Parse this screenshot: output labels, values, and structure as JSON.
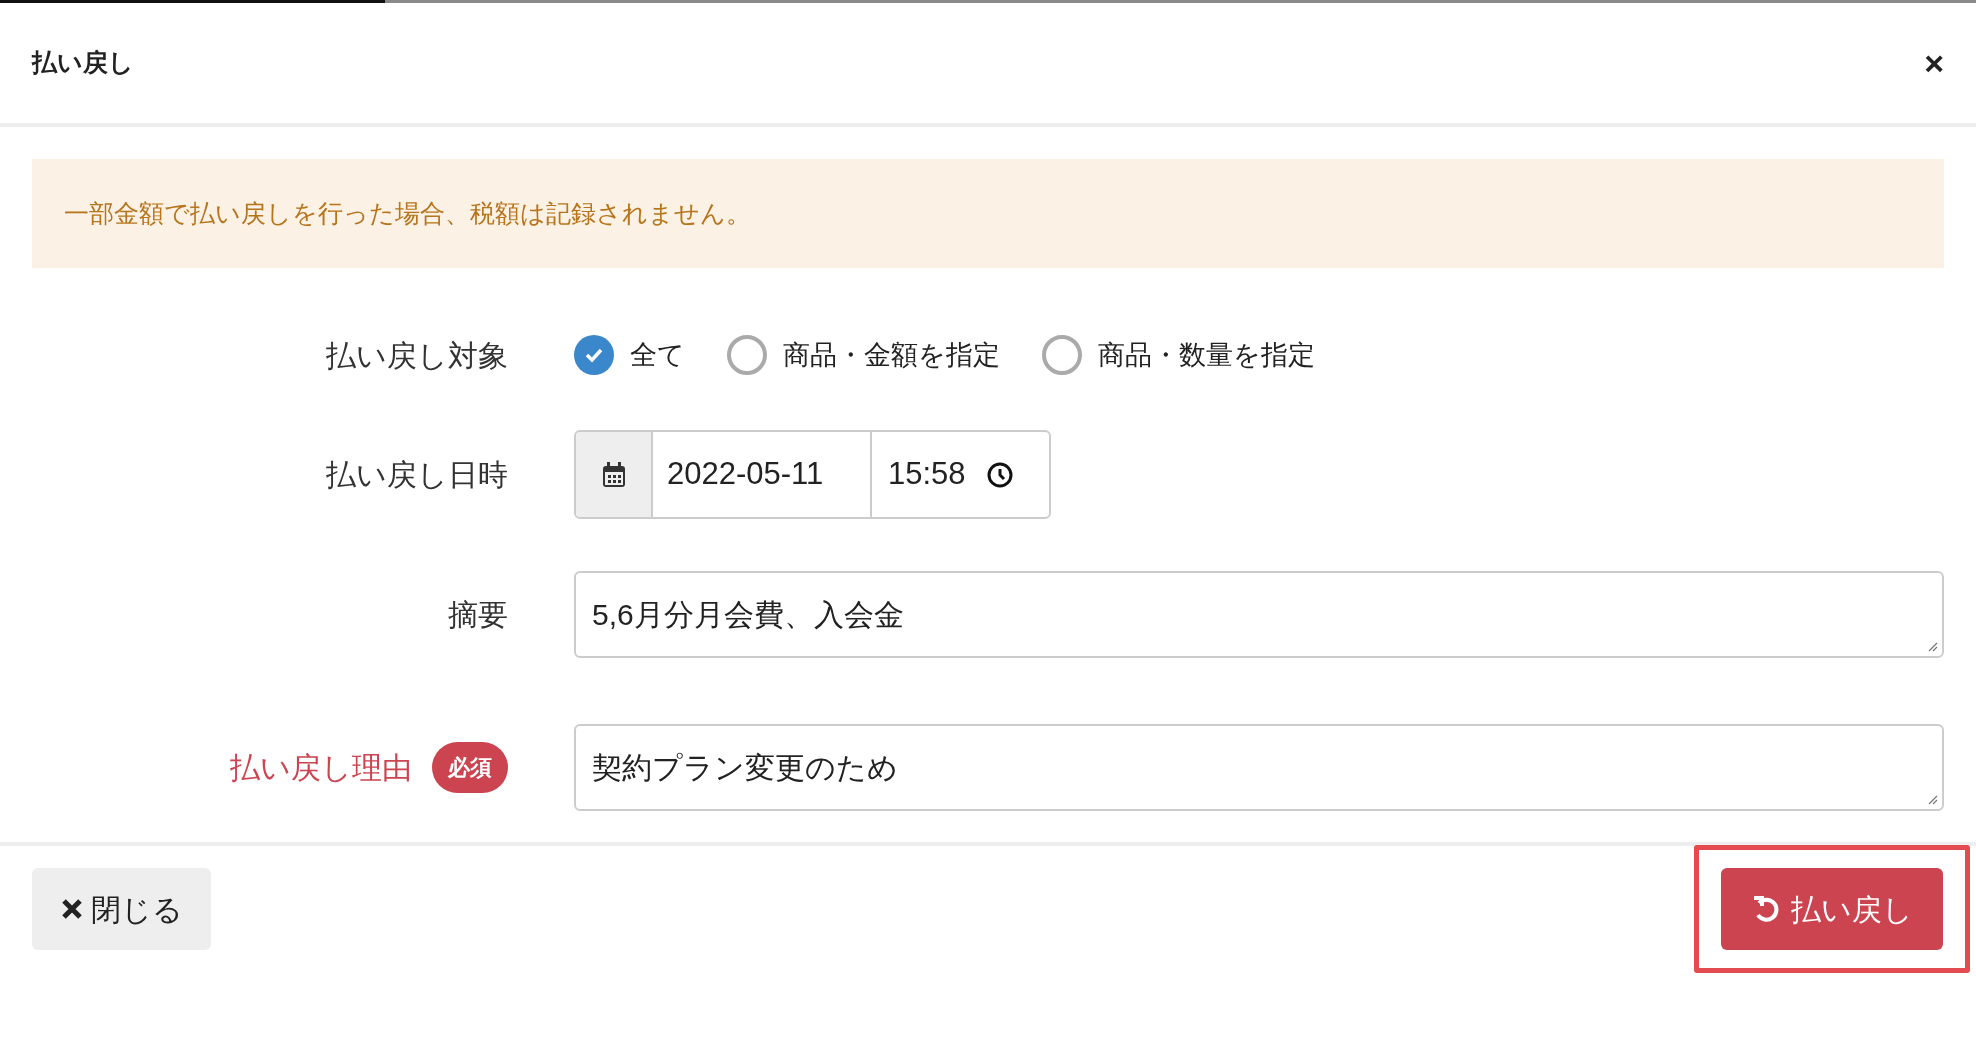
{
  "progress": {
    "level": 0.195
  },
  "title": "払い戻し",
  "close_icon": "×",
  "alert": "一部金額で払い戻しを行った場合、税額は記録されません。",
  "target": {
    "label": "払い戻し対象",
    "options": [
      {
        "label": "全て",
        "selected": true
      },
      {
        "label": "商品・金額を指定",
        "selected": false
      },
      {
        "label": "商品・数量を指定",
        "selected": false
      }
    ]
  },
  "datetime": {
    "label": "払い戻し日時",
    "date": "2022-05-11",
    "time": "15:58"
  },
  "summary": {
    "label": "摘要",
    "value": "5,6月分月会費、入会金"
  },
  "reason": {
    "label": "払い戻し理由",
    "required_badge": "必須",
    "value": "契約プラン変更のため"
  },
  "footer": {
    "close_button": "閉じる",
    "refund_button": "払い戻し",
    "refund_highlighted": true
  }
}
